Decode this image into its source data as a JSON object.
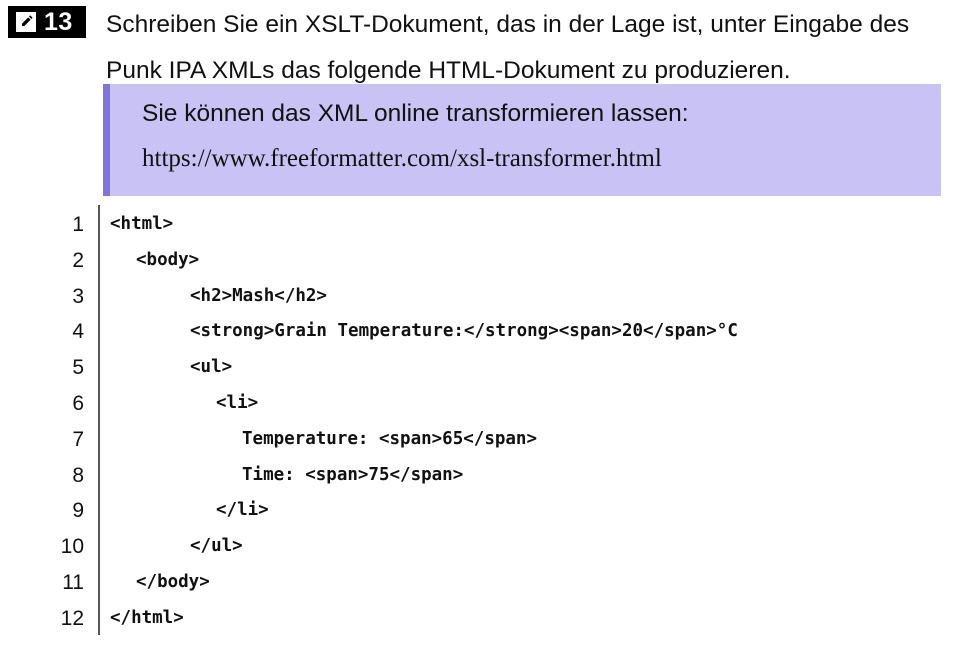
{
  "task": {
    "icon": "pencil-edit-icon",
    "number": "13",
    "line1": "Schreiben Sie ein XSLT-Dokument, das in der Lage ist, unter Eingabe des",
    "line2": "Punk IPA XMLs das folgende HTML-Dokument zu produzieren."
  },
  "info": {
    "text": "Sie können das XML online transformieren lassen:",
    "url": "https://www.freeformatter.com/xsl-transformer.html",
    "background_color": "#c9c2f4",
    "border_color": "#7f74de"
  },
  "code": {
    "lines": [
      {
        "number": "1",
        "text": "<html>"
      },
      {
        "number": "2",
        "text": "<body>"
      },
      {
        "number": "3",
        "text": "<h2>Mash</h2>"
      },
      {
        "number": "4",
        "text": "<strong>Grain Temperature:</strong><span>20</span>°C"
      },
      {
        "number": "5",
        "text": "<ul>"
      },
      {
        "number": "6",
        "text": "<li>"
      },
      {
        "number": "7",
        "text": "Temperature: <span>65</span>"
      },
      {
        "number": "8",
        "text": "Time: <span>75</span>"
      },
      {
        "number": "9",
        "text": "</li>"
      },
      {
        "number": "10",
        "text": "</ul>"
      },
      {
        "number": "11",
        "text": "</body>"
      },
      {
        "number": "12",
        "text": "</html>"
      }
    ]
  }
}
